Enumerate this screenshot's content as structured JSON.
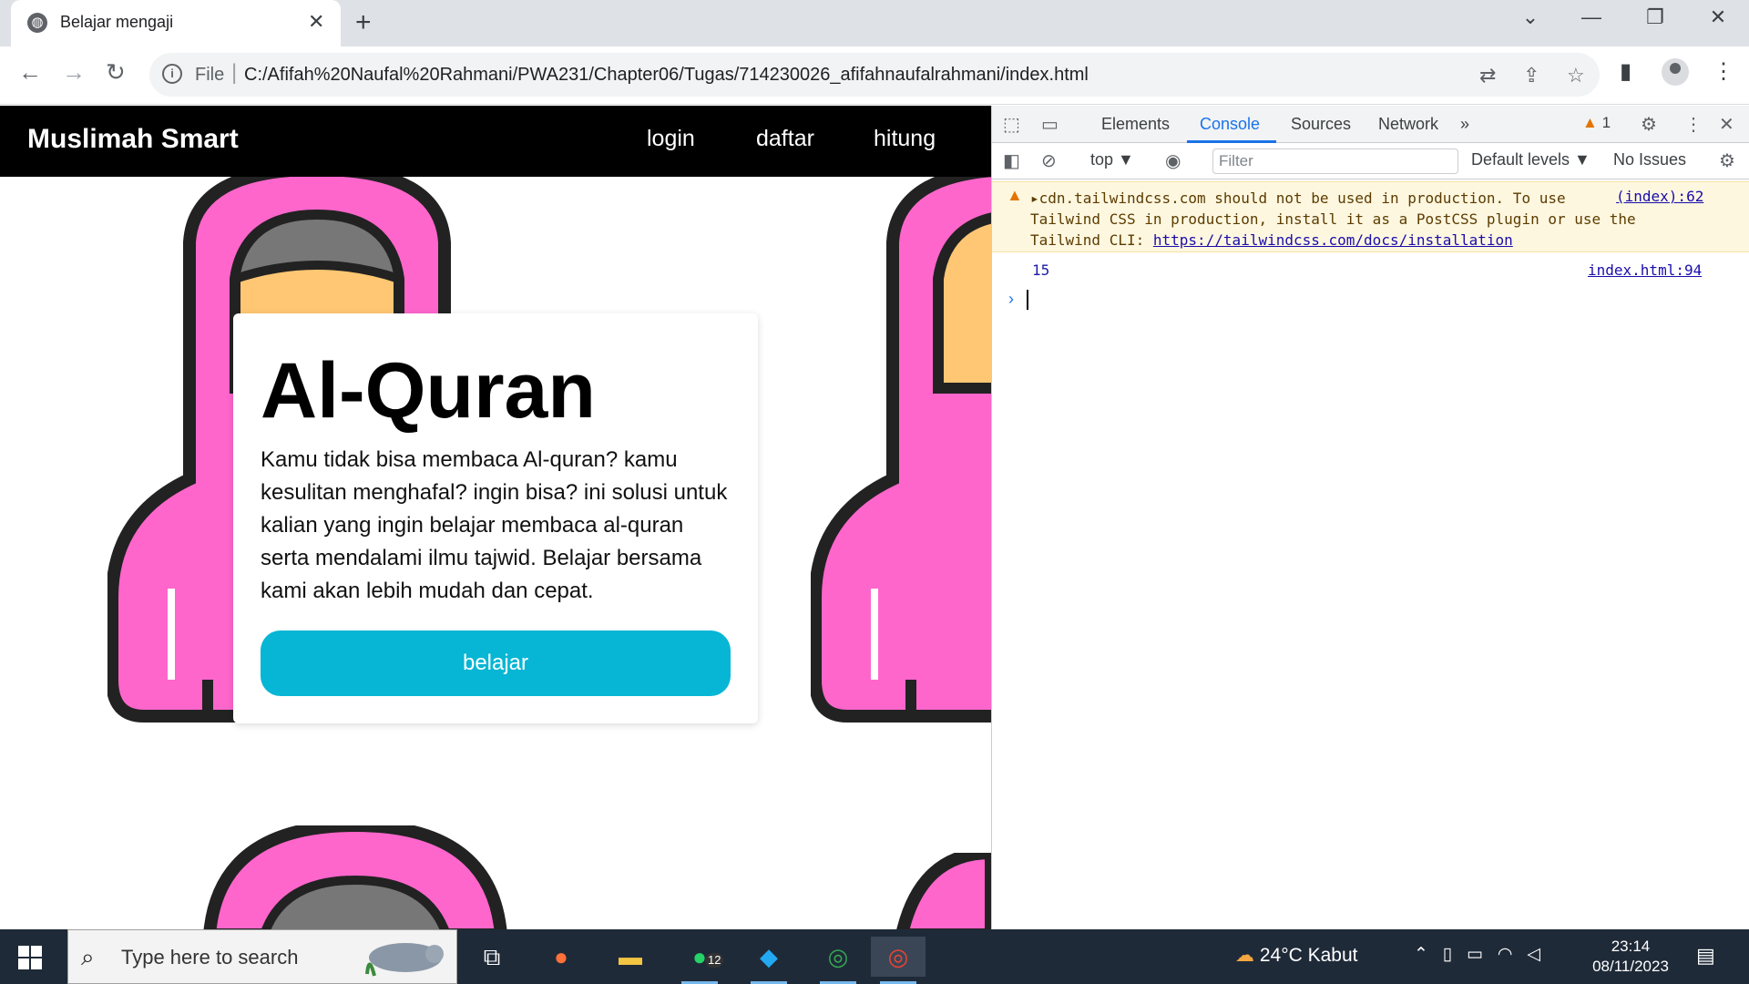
{
  "browser": {
    "tab_title": "Belajar mengaji",
    "tab_close": "✕",
    "new_tab": "+",
    "window_controls": [
      "⌄",
      "—",
      "❐",
      "✕"
    ],
    "nav": {
      "back": "←",
      "forward": "→",
      "reload": "↻"
    },
    "omnibox": {
      "info": "i",
      "scheme": "File",
      "separator": "|",
      "url": "C:/Afifah%20Naufal%20Rahmani/PWA231/Chapter06/Tugas/714230026_afifahnaufalrahmani/index.html"
    },
    "icons": {
      "translate": "⇄",
      "share": "⇪",
      "bookmark": "☆",
      "sidepanel": "▮",
      "menu": "⋮"
    }
  },
  "page": {
    "brand": "Muslimah Smart",
    "nav_links": [
      "login",
      "daftar",
      "hitung"
    ],
    "card": {
      "title": "Al-Quran",
      "body": "Kamu tidak bisa membaca Al-quran? kamu kesulitan menghafal? ingin bisa? ini solusi untuk kalian yang ingin belajar membaca al-quran serta mendalami ilmu tajwid. Belajar bersama kami akan lebih mudah dan cepat.",
      "button": "belajar"
    },
    "colors": {
      "accent": "#06b6d4",
      "hijab": "#ff66cc",
      "face": "#ffc773"
    }
  },
  "devtools": {
    "tabs": [
      "Elements",
      "Console",
      "Sources",
      "Network"
    ],
    "more_tabs": "»",
    "warning_count": "1",
    "context": "top",
    "filter_placeholder": "Filter",
    "levels": "Default levels ▼",
    "issues": "No Issues",
    "messages": {
      "warning_line1": "▸cdn.tailwindcss.com should not be used in production. To use",
      "warning_line2": "Tailwind CSS in production, install it as a PostCSS plugin or use the",
      "warning_line3_prefix": "Tailwind CLI: ",
      "warning_link": "https://tailwindcss.com/docs/installation",
      "warning_source": "(index):62",
      "log_value": "15",
      "log_source": "index.html:94"
    },
    "prompt": "›"
  },
  "taskbar": {
    "search_placeholder": "Type here to search",
    "whatsapp_badge": "12",
    "weather": "24°C  Kabut",
    "time": "23:14",
    "date": "08/11/2023"
  }
}
